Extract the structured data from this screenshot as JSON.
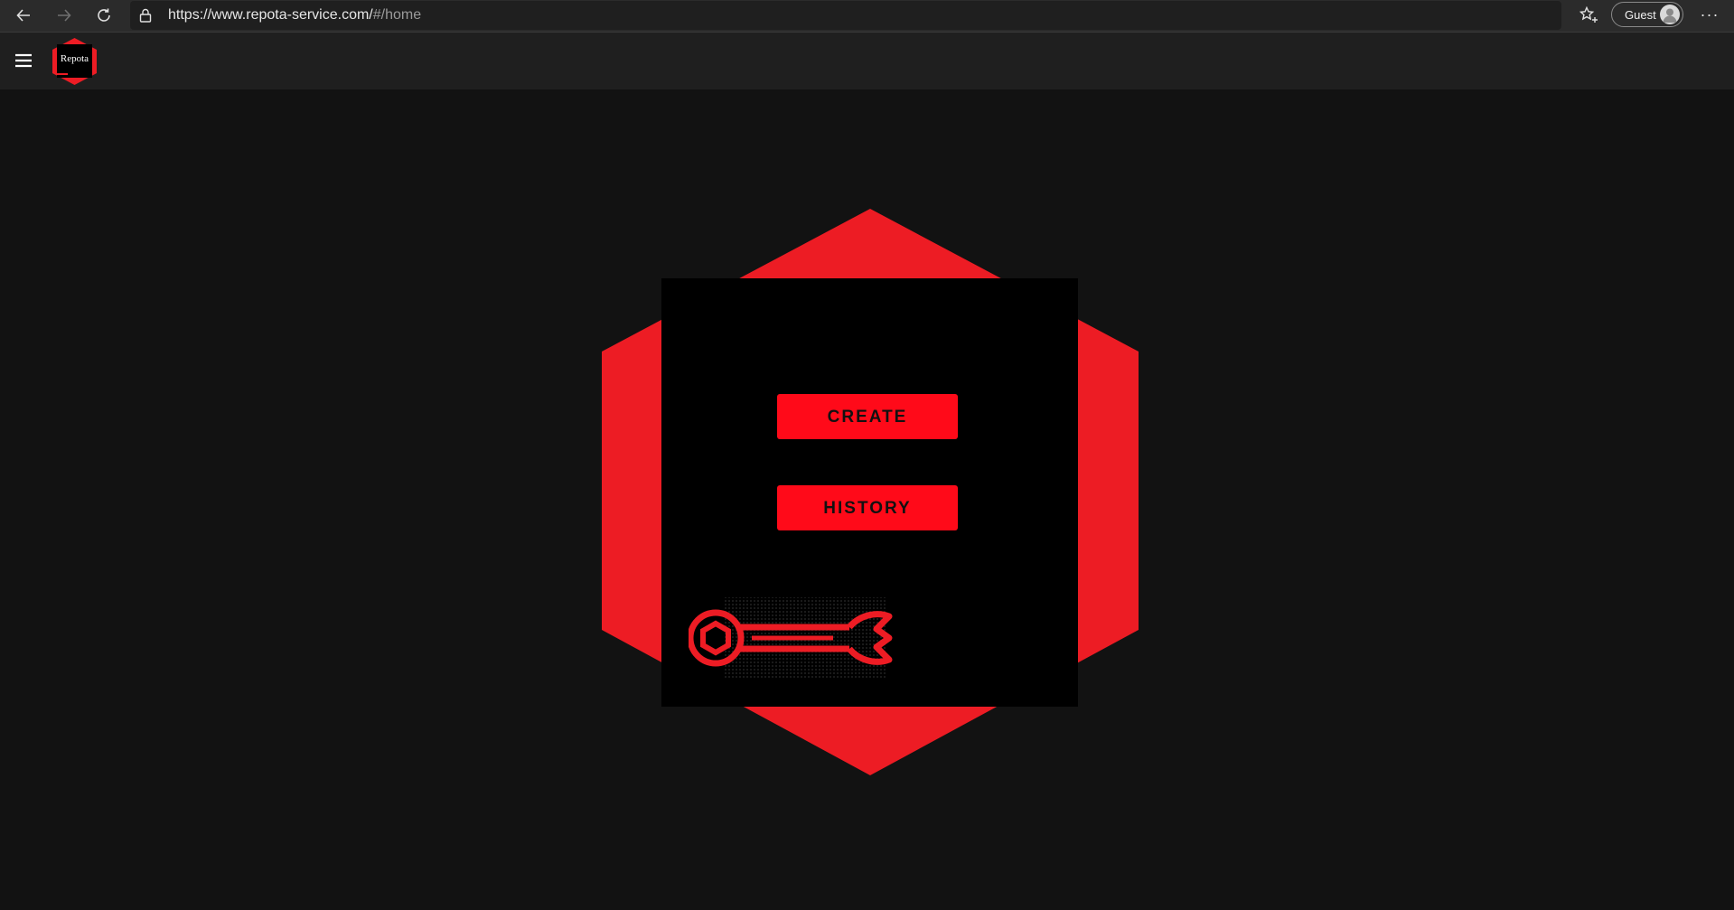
{
  "browser": {
    "url_main": "https://www.repota-service.com/",
    "url_path": "#/home",
    "profile_label": "Guest",
    "more_label": "···"
  },
  "app": {
    "logo_text": "Repota"
  },
  "hero": {
    "create_label": "CREATE",
    "history_label": "HISTORY"
  },
  "colors": {
    "accent": "#ed1c24",
    "button": "#ff0a19",
    "background": "#121212",
    "header": "#1f1f1f",
    "panel": "#000000"
  },
  "icons": {
    "back": "arrow-left-icon",
    "forward": "arrow-right-icon",
    "reload": "reload-icon",
    "lock": "lock-icon",
    "favorites": "star-plus-icon",
    "avatar": "person-icon",
    "menu": "hamburger-icon",
    "wrench": "wrench-icon"
  }
}
